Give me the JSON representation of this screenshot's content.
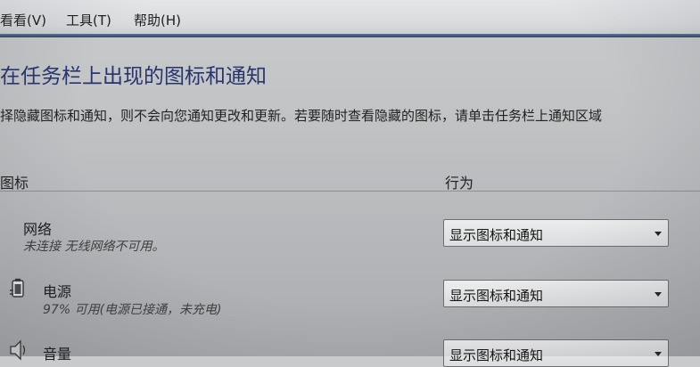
{
  "menu": {
    "view": "看看(V)",
    "tools": "工具(T)",
    "help": "帮助(H)"
  },
  "page": {
    "title": "在任务栏上出现的图标和通知",
    "description": "择隐藏图标和通知，则不会向您通知更改和更新。若要随时查看隐藏的图标，请单击任务栏上通知区域"
  },
  "table": {
    "header_icon": "图标",
    "header_behavior": "行为",
    "rows": [
      {
        "name": "网络",
        "status": "未连接 无线网络不可用。",
        "behavior": "显示图标和通知",
        "icon": "network-icon"
      },
      {
        "name": "电源",
        "status": "97% 可用(电源已接通，未充电)",
        "behavior": "显示图标和通知",
        "icon": "power-icon"
      },
      {
        "name": "音量",
        "status": "",
        "behavior": "显示图标和通知",
        "icon": "volume-icon"
      }
    ]
  },
  "colors": {
    "title": "#26356e",
    "menubar_bottom": "#2f4466"
  }
}
